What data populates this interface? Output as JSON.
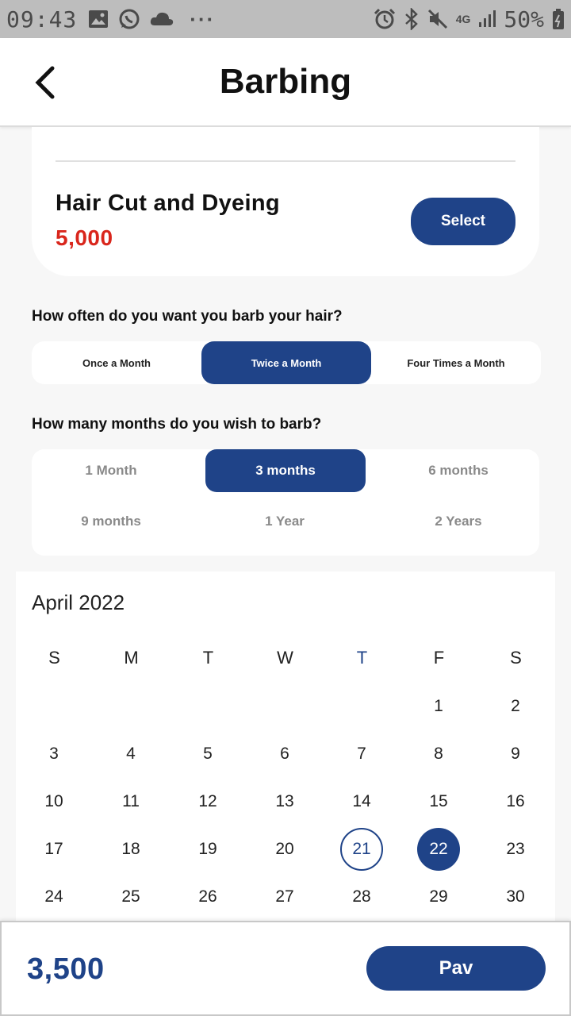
{
  "status_bar": {
    "time": "09:43",
    "dots": "···",
    "network": "4G",
    "battery": "50%",
    "icons": [
      "gallery-icon",
      "whatsapp-icon",
      "cloud-icon",
      "alarm-icon",
      "bluetooth-icon",
      "mute-icon",
      "signal-icon",
      "battery-icon"
    ]
  },
  "header": {
    "title": "Barbing",
    "back_icon": "chevron-left-icon"
  },
  "service": {
    "name": "Hair Cut and Dyeing",
    "price": "5,000",
    "select_label": "Select"
  },
  "frequency": {
    "question": "How often do you want you barb your hair?",
    "options": [
      "Once a Month",
      "Twice a Month",
      "Four Times a Month"
    ],
    "selected": "Twice a Month"
  },
  "duration": {
    "question": "How many months do you wish to barb?",
    "options": [
      "1 Month",
      "3 months",
      "6 months",
      "9 months",
      "1 Year",
      "2 Years"
    ],
    "selected": "3 months"
  },
  "calendar": {
    "month_label": "April 2022",
    "weekdays": [
      "S",
      "M",
      "T",
      "W",
      "T",
      "F",
      "S"
    ],
    "today_weekday_index": 4,
    "first_weekday_index": 5,
    "visible_days": 30,
    "today": 21,
    "selected": 22
  },
  "footer": {
    "total": "3,500",
    "pay_label": "Pav"
  },
  "colors": {
    "primary": "#1f4388",
    "price_red": "#d9261c",
    "muted_text": "#8a8a8a"
  }
}
